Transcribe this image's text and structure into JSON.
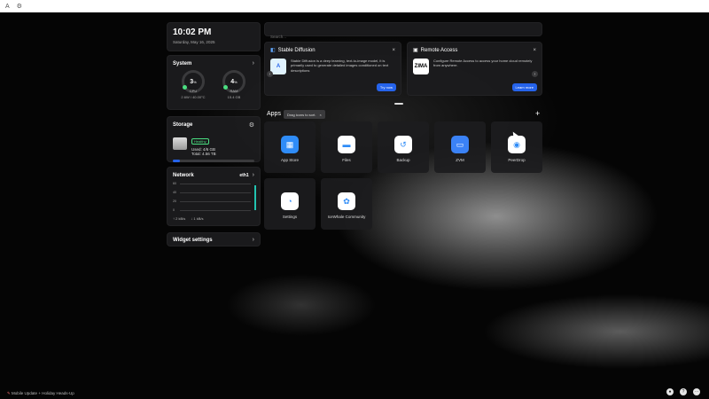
{
  "topbar": {
    "icon1": "A",
    "icon2": "⚙"
  },
  "clock": {
    "time": "10:02 PM",
    "date": "Saturday, May 16, 2025"
  },
  "system": {
    "title": "System",
    "cpu": {
      "value": "3",
      "unit": "%",
      "label": "CPU",
      "sub": "2.6W / 40.00°C"
    },
    "ram": {
      "value": "4",
      "unit": "%",
      "label": "RAM",
      "sub": "15.4 GB"
    }
  },
  "storage": {
    "title": "Storage",
    "status": "Healthy",
    "used": "Used: 4/6 GB",
    "total": "Total: 4.56 TB",
    "usage_fraction": 0.09
  },
  "network": {
    "title": "Network",
    "iface": "eth1",
    "y_labels": [
      "60",
      "40",
      "20",
      "0"
    ],
    "up": "2 kB/s",
    "down": "1 kB/s"
  },
  "widget_settings": {
    "label": "Widget settings"
  },
  "search": {
    "placeholder": "Search..."
  },
  "promo1": {
    "title": "Stable Diffusion",
    "desc": "Stable Diffusion is a deep learning, text-to-image model, it is primarily used to generate detailed images conditioned on text descriptions",
    "button": "Try now"
  },
  "promo2": {
    "title": "Remote Access",
    "logo": "ZIMA",
    "desc": "Configure Remote Access to access your home cloud remotely from anywhere.",
    "button": "Learn more"
  },
  "apps": {
    "title": "Apps",
    "drag_hint": "Drag icons to sort.",
    "items": [
      {
        "name": "App Store",
        "icon": "app-store-icon",
        "color": "#2f8cf7"
      },
      {
        "name": "Files",
        "icon": "files-icon",
        "color": "#ffffff"
      },
      {
        "name": "Backup",
        "icon": "backup-icon",
        "color": "#ffffff"
      },
      {
        "name": "ZVM",
        "icon": "zvm-icon",
        "color": "#3b82f6"
      },
      {
        "name": "PeerDrop",
        "icon": "peerdrop-icon",
        "color": "#ffffff"
      },
      {
        "name": "Settings",
        "icon": "settings-icon",
        "color": "#ffffff"
      },
      {
        "name": "IceWhale Community",
        "icon": "community-icon",
        "color": "#ffffff"
      }
    ]
  },
  "footer": {
    "note": "Mobile Update + Holiday Heads-Up"
  }
}
